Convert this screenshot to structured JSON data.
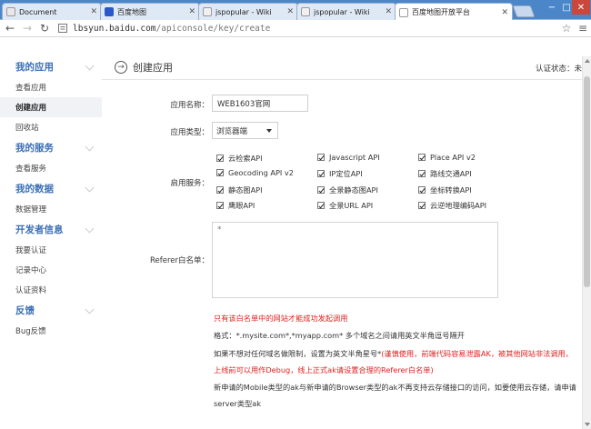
{
  "browser": {
    "tabs": [
      {
        "label": "Document",
        "icon": "document-icon",
        "active": false
      },
      {
        "label": "百度地图",
        "icon": "baidu-paw-icon",
        "active": false
      },
      {
        "label": "jspopular - Wiki",
        "icon": "wiki-icon",
        "active": false
      },
      {
        "label": "jspopular - Wiki",
        "icon": "wiki-icon",
        "active": false
      },
      {
        "label": "百度地图开放平台",
        "icon": "page-icon",
        "active": true
      }
    ],
    "close_glyph": "✕",
    "url_host": "lbsyun.baidu.com",
    "url_path": "/apiconsole/key/create"
  },
  "sidebar": {
    "sections": [
      {
        "title": "我的应用",
        "items": [
          {
            "label": "查看应用",
            "active": false
          },
          {
            "label": "创建应用",
            "active": true
          },
          {
            "label": "回收站",
            "active": false
          }
        ]
      },
      {
        "title": "我的服务",
        "items": [
          {
            "label": "查看服务",
            "active": false
          }
        ]
      },
      {
        "title": "我的数据",
        "items": [
          {
            "label": "数据管理",
            "active": false
          }
        ]
      },
      {
        "title": "开发者信息",
        "items": [
          {
            "label": "我要认证",
            "active": false
          },
          {
            "label": "记录中心",
            "active": false
          },
          {
            "label": "认证资料",
            "active": false
          }
        ]
      },
      {
        "title": "反馈",
        "items": [
          {
            "label": "Bug反馈",
            "active": false
          }
        ]
      }
    ]
  },
  "main": {
    "title": "创建应用",
    "cert_status": "认证状态：未",
    "form": {
      "name_label": "应用名称：",
      "name_value": "WEB1603官网",
      "type_label": "应用类型：",
      "type_value": "浏览器端",
      "services_label": "启用服务：",
      "services": [
        [
          "云检索API",
          "Javascript API",
          "Place API v2"
        ],
        [
          "Geocoding API v2",
          "IP定位API",
          "路线交通API"
        ],
        [
          "静态图API",
          "全景静态图API",
          "坐标转换API"
        ],
        [
          "鹰眼API",
          "全景URL API",
          "云逆地理编码API"
        ]
      ],
      "referer_label": "Referer白名单：",
      "referer_value": "*"
    },
    "notes": {
      "warn": "只有该白名单中的网站才能成功发起调用",
      "format": "格式：*.mysite.com*,*myapp.com* 多个域名之间请用英文半角逗号隔开",
      "nolimit_a": "如果不想对任何域名做限制，设置为英文半角星号*",
      "nolimit_b": "(谨慎使用，前端代码容易泄露AK，被其他网站非法调用，",
      "nolimit_c": "上线前可以用作Debug，线上正式ak请设置合理的Referer白名单)",
      "mobile_a": "新申请的Mobile类型的ak与新申请的Browser类型的ak不再支持云存储接口的访问，如要使用云存储，请申请",
      "mobile_b": "server类型ak"
    }
  },
  "colors": {
    "tab_strip": "#4a86c8",
    "sidebar_heading": "#3b6fb6",
    "warning_red": "#e02020"
  }
}
